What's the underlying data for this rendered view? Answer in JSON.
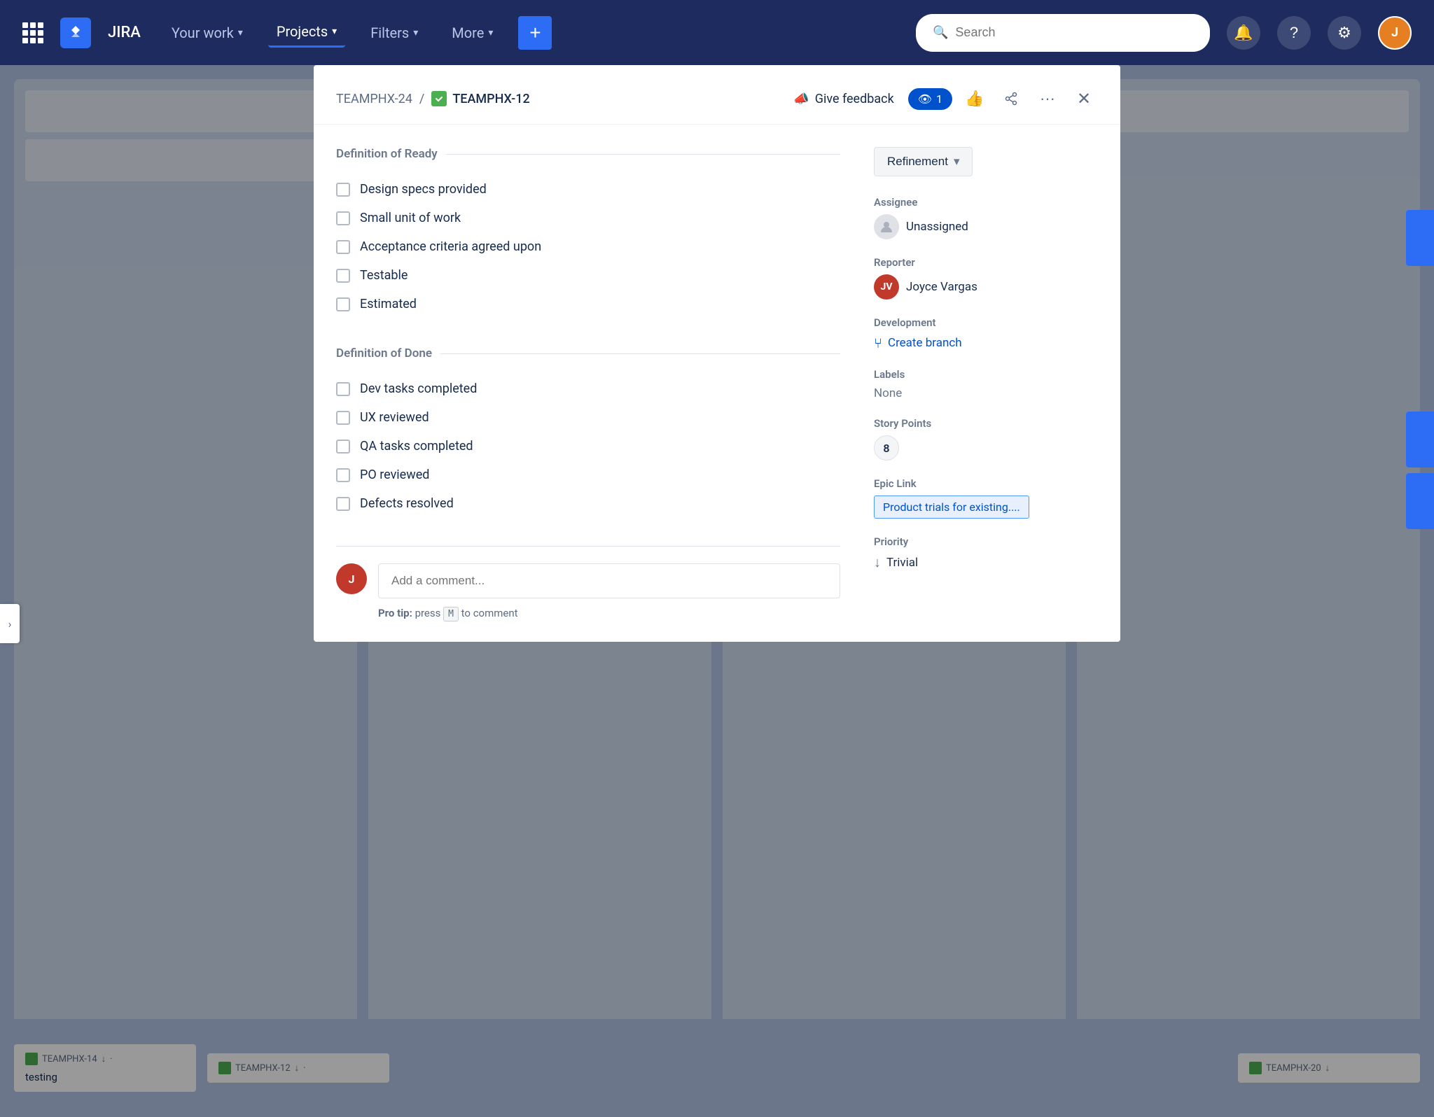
{
  "navbar": {
    "brand": "JIRA",
    "your_work_label": "Your work",
    "projects_label": "Projects",
    "filters_label": "Filters",
    "more_label": "More",
    "search_placeholder": "Search"
  },
  "modal": {
    "breadcrumb_parent": "TEAMPHX-24",
    "breadcrumb_current": "TEAMPHX-12",
    "give_feedback_label": "Give feedback",
    "watch_count": "1",
    "sprint_label": "Refinement",
    "definition_of_ready_title": "Definition of Ready",
    "ready_items": [
      "Design specs provided",
      "Small unit of work",
      "Acceptance criteria agreed upon",
      "Testable",
      "Estimated"
    ],
    "definition_of_done_title": "Definition of Done",
    "done_items": [
      "Dev tasks completed",
      "UX reviewed",
      "QA tasks completed",
      "PO reviewed",
      "Defects resolved"
    ],
    "comment_placeholder": "Add a comment...",
    "pro_tip_text": "Pro tip:",
    "pro_tip_key": "M",
    "pro_tip_suffix": "to comment",
    "assignee_label": "Assignee",
    "assignee_value": "Unassigned",
    "reporter_label": "Reporter",
    "reporter_value": "Joyce Vargas",
    "development_label": "Development",
    "create_branch_label": "Create branch",
    "labels_label": "Labels",
    "labels_value": "None",
    "story_points_label": "Story Points",
    "story_points_value": "8",
    "epic_link_label": "Epic Link",
    "epic_link_value": "Product trials for existing....",
    "priority_label": "Priority",
    "priority_value": "Trivial"
  },
  "board_bottom": {
    "cards": [
      {
        "id": "TEAMPHX-14",
        "text": "testing"
      },
      {
        "id": "TEAMPHX-12",
        "text": ""
      },
      {
        "id": "TEAMPHX-20",
        "text": ""
      }
    ]
  }
}
